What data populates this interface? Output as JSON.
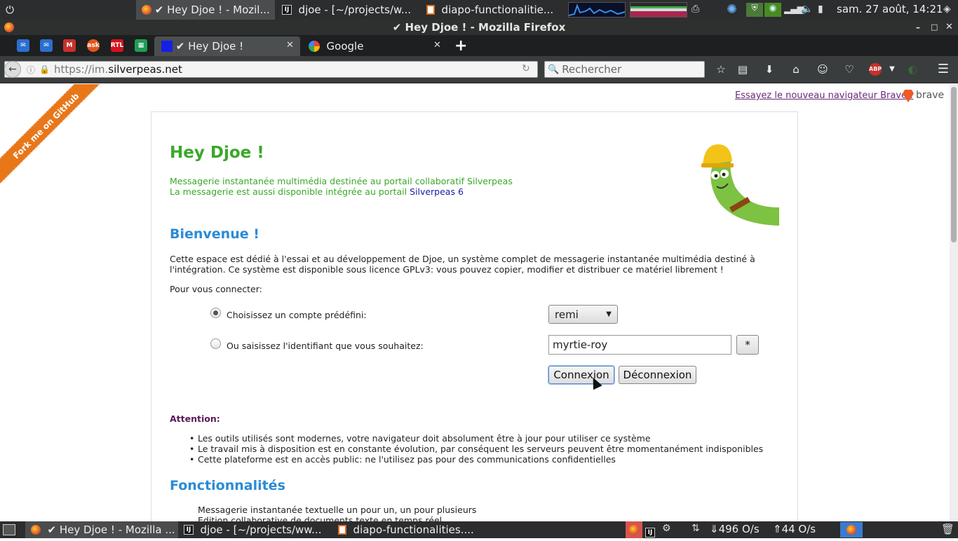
{
  "system_panel": {
    "windows": [
      {
        "label": "✔ Hey Djoe ! - Mozil..."
      },
      {
        "label": "djoe - [~/projects/w..."
      },
      {
        "label": "diapo-functionalitie..."
      }
    ],
    "clock": "sam. 27 août, 14:21"
  },
  "window_title": "✔ Hey Djoe ! - Mozilla Firefox",
  "tabs": [
    {
      "label": "✔ Hey Djoe !"
    },
    {
      "label": "Google"
    }
  ],
  "pinned_tabs": [
    "ask",
    "RTL"
  ],
  "url": {
    "prefix": "https://im.",
    "domain": "silverpeas.net"
  },
  "search_placeholder": "Rechercher",
  "page": {
    "fork_ribbon": "Fork me on GitHub",
    "brave_link": "Essayez le nouveau navigateur Brave !",
    "brave_label": "brave",
    "title": "Hey Djoe !",
    "subtitle_line1": "Messagerie instantanée multimédia destinée au portail collaboratif Silverpeas",
    "subtitle_line2": "La messagerie est aussi disponible intégrée au portail",
    "subtitle_link": "Silverpeas 6",
    "welcome_heading": "Bienvenue !",
    "welcome_text": "Cette espace est dédié à l'essai et au développement de Djoe, un système complet de messagerie instantanée multimédia destiné à l'intégration. Ce système est disponible sous licence GPLv3: vous pouvez copier, modifier et distribuer ce matériel librement !",
    "connect_label": "Pour vous connecter:",
    "option_predefined": "Choisissez un compte prédéfini:",
    "option_custom": "Ou saisissez l'identifiant que vous souhaitez:",
    "account_select_value": "remi",
    "username_value": "myrtie-roy",
    "random_button": "*",
    "connect_button": "Connexion",
    "disconnect_button": "Déconnexion",
    "attention_label": "Attention:",
    "attention_items": [
      "Les outils utilisés sont modernes, votre navigateur doit absolument être à jour pour utiliser ce système",
      "Le travail mis à disposition est en constante évolution, par conséquent les serveurs peuvent être momentanément indisponibles",
      "Cette plateforme est en accès public: ne l'utilisez pas pour des communications confidentielles"
    ],
    "features_heading": "Fonctionnalités",
    "feature_items": [
      "Messagerie instantanée textuelle un pour un, un pour plusieurs",
      "Edition collaborative de documents texte en temps réel"
    ]
  },
  "taskbar": {
    "tasks": [
      {
        "label": "✔ Hey Djoe ! - Mozilla ..."
      },
      {
        "label": "djoe - [~/projects/ww..."
      },
      {
        "label": "diapo-functionalities...."
      }
    ],
    "net_down": "496 O/s",
    "net_up": "44 O/s"
  }
}
